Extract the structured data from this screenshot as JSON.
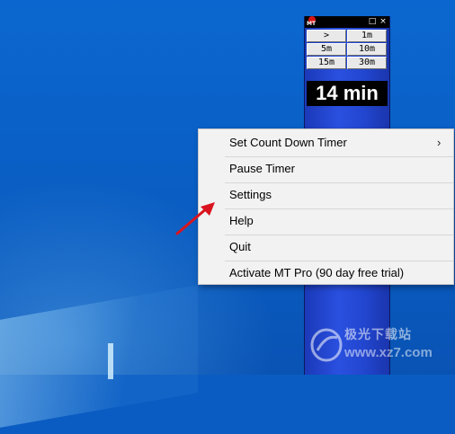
{
  "widget": {
    "logo_text": "MT",
    "restore_glyph": "□",
    "close_glyph": "×",
    "buttons": [
      {
        "label": ">"
      },
      {
        "label": "1m"
      },
      {
        "label": "5m"
      },
      {
        "label": "10m"
      },
      {
        "label": "15m"
      },
      {
        "label": "30m"
      }
    ],
    "time_display": "14 min",
    "body_color": "#2a50e0"
  },
  "menu": {
    "items": [
      {
        "label": "Set Count Down Timer",
        "has_submenu": true,
        "arrow": "›"
      },
      {
        "label": "Pause Timer"
      },
      {
        "label": "Settings"
      },
      {
        "label": "Help"
      },
      {
        "label": "Quit"
      },
      {
        "label": "Activate MT Pro (90 day free trial)"
      }
    ]
  },
  "annotation": {
    "arrow_color": "#d9141e"
  },
  "watermark": {
    "text": "极光下载站",
    "url": "www.xz7.com"
  }
}
